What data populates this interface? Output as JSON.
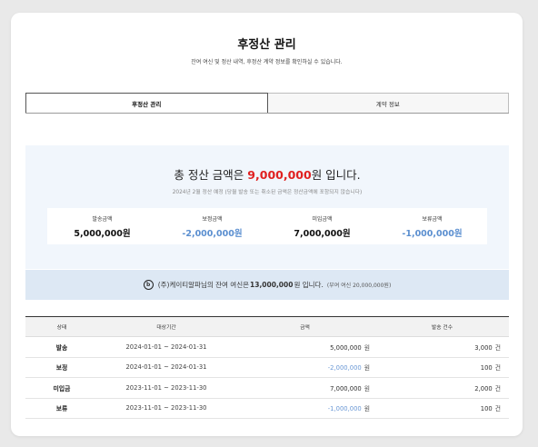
{
  "header": {
    "title": "후정산 관리",
    "subtitle": "잔여 여신 및 정산 내역, 후정산 계약 정보를 확인하실 수 있습니다."
  },
  "tabs": [
    {
      "label": "후정산 관리",
      "active": true
    },
    {
      "label": "계약 정보",
      "active": false
    }
  ],
  "summary": {
    "total_prefix": "총 정산 금액은",
    "total_amount": "9,000,000",
    "total_suffix": "원 입니다.",
    "note": "2024년 2월 정산 예정 (당월 발송 또는 취소된 금액은 정산금액에 포함되지 않습니다)",
    "boxes": [
      {
        "label": "발송금액",
        "value": "5,000,000원"
      },
      {
        "label": "보정금액",
        "value": "-2,000,000원"
      },
      {
        "label": "미입금액",
        "value": "7,000,000원"
      },
      {
        "label": "보류금액",
        "value": "-1,000,000원"
      }
    ]
  },
  "credit": {
    "icon_char": "b",
    "prefix": "(주)케이티알파님의 잔여 여신은",
    "amount": "13,000,000",
    "suffix": "원 입니다.",
    "limit": "(부여 여신 20,000,000원)"
  },
  "table": {
    "headers": [
      "상태",
      "대상기간",
      "금액",
      "발송 건수"
    ],
    "amount_unit": "원",
    "count_unit": "건",
    "rows": [
      {
        "status": "발송",
        "period": "2024-01-01 ~ 2024-01-31",
        "amount": "5,000,000",
        "count": "3,000"
      },
      {
        "status": "보정",
        "period": "2024-01-01 ~ 2024-01-31",
        "amount": "-2,000,000",
        "count": "100"
      },
      {
        "status": "미입금",
        "period": "2023-11-01 ~ 2023-11-30",
        "amount": "7,000,000",
        "count": "2,000"
      },
      {
        "status": "보류",
        "period": "2023-11-01 ~ 2023-11-30",
        "amount": "-1,000,000",
        "count": "100"
      }
    ]
  },
  "colors": {
    "total_amount": "#e02020",
    "negative": "#5b8fd0",
    "summary_bg": "#f1f6fc",
    "credit_bg": "#dde8f4"
  }
}
